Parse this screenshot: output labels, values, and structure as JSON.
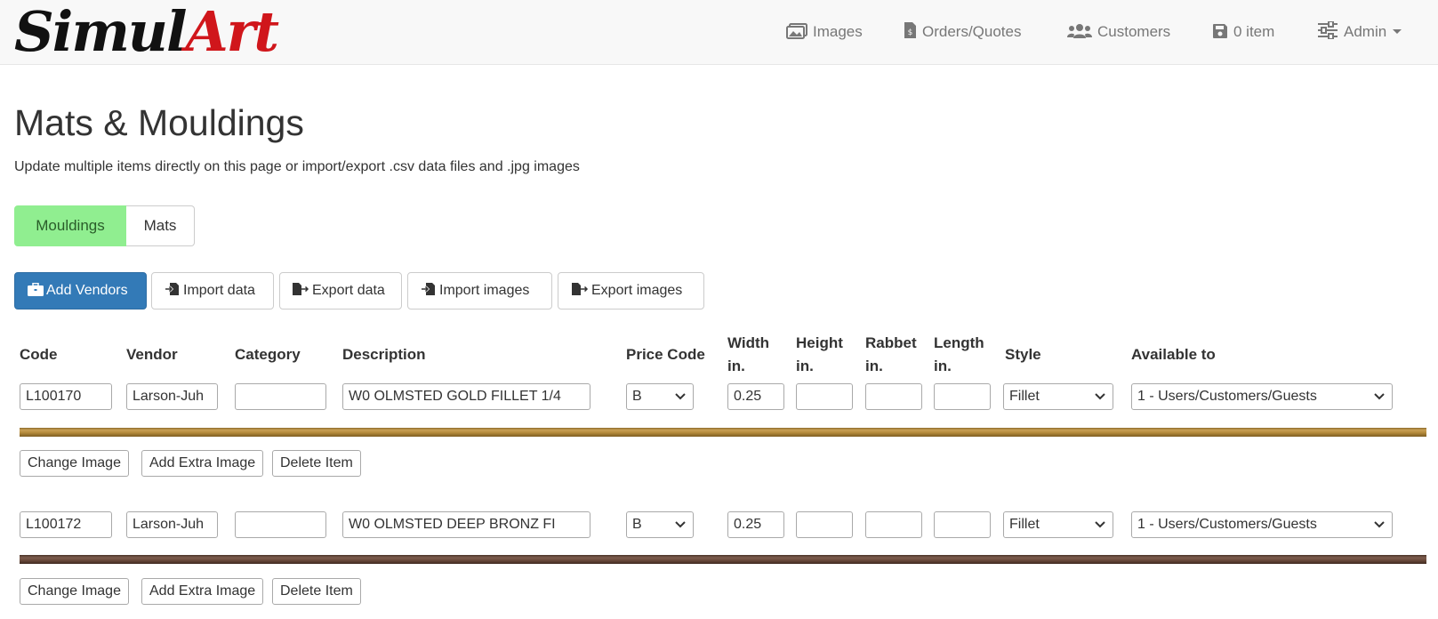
{
  "brand": {
    "part1": "Simul",
    "part2": "Art"
  },
  "nav": {
    "images": "Images",
    "orders": "Orders/Quotes",
    "customers": "Customers",
    "cart": "0 item",
    "admin": "Admin"
  },
  "page": {
    "title": "Mats & Mouldings",
    "subtitle": "Update multiple items directly on this page or import/export .csv data files and .jpg images"
  },
  "toggle": {
    "mouldings": "Mouldings",
    "mats": "Mats"
  },
  "actions": {
    "add_vendors": "Add Vendors",
    "import_data": "Import data",
    "export_data": "Export data",
    "import_images": "Import images",
    "export_images": "Export images"
  },
  "columns": {
    "code": "Code",
    "vendor": "Vendor",
    "category": "Category",
    "description": "Description",
    "price_code": "Price Code",
    "width_1": "Width",
    "width_2": "in.",
    "height_1": "Height",
    "height_2": "in.",
    "rabbet_1": "Rabbet",
    "rabbet_2": "in.",
    "length_1": "Length",
    "length_2": "in.",
    "style": "Style",
    "available": "Available to"
  },
  "rows": [
    {
      "code": "L100170",
      "vendor": "Larson-Juh",
      "category": "",
      "description": "W0 OLMSTED GOLD FILLET 1/4",
      "price_code": "B",
      "width": "0.25",
      "height": "",
      "rabbet": "",
      "length": "",
      "style": "Fillet",
      "available": "1 - Users/Customers/Guests"
    },
    {
      "code": "L100172",
      "vendor": "Larson-Juh",
      "category": "",
      "description": "W0 OLMSTED DEEP BRONZ FI",
      "price_code": "B",
      "width": "0.25",
      "height": "",
      "rabbet": "",
      "length": "",
      "style": "Fillet",
      "available": "1 - Users/Customers/Guests"
    }
  ],
  "row_buttons": {
    "change_image": "Change Image",
    "add_extra_image": "Add Extra Image",
    "delete_item": "Delete Item"
  },
  "colors": {
    "primary": "#337ab7",
    "toggle_active": "#90ee90",
    "brand_red": "#d0161b",
    "moulding_gold": "#b68b3c",
    "moulding_bronze": "#6a4a3b"
  }
}
